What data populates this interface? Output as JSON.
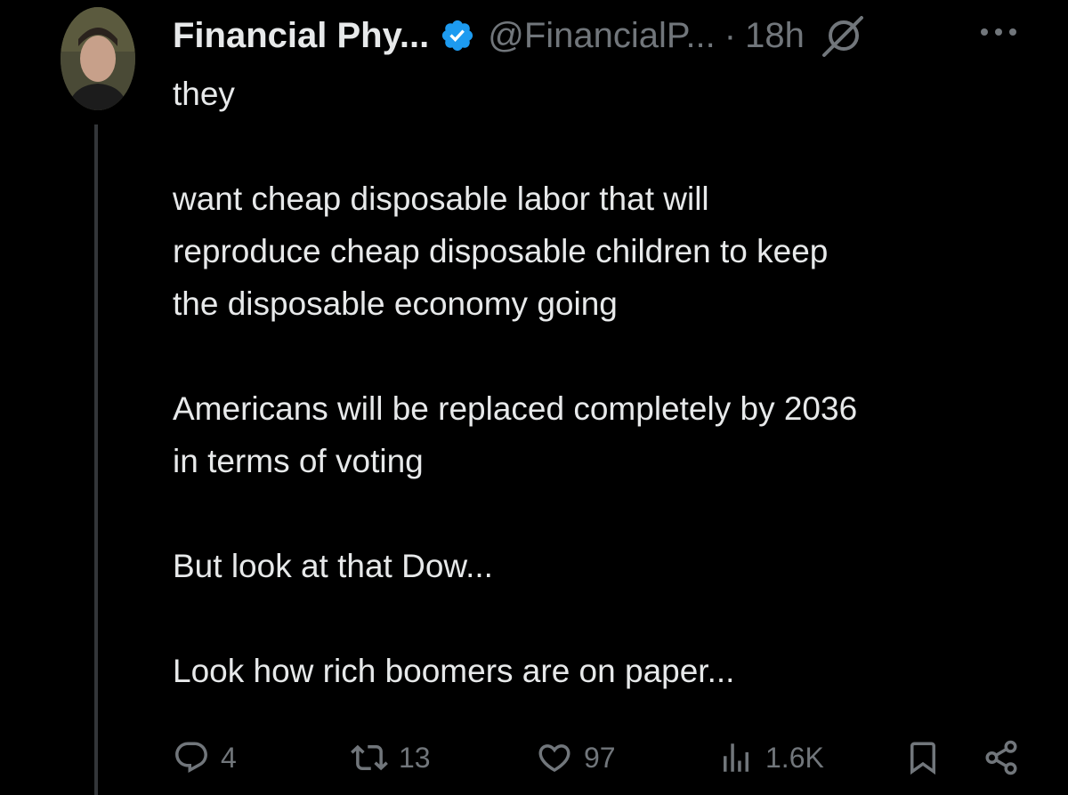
{
  "author": {
    "display_name": "Financial Phy...",
    "handle": "@FinancialP...",
    "separator": "·",
    "time": "18h",
    "verified_color": "#1d9bf0"
  },
  "post": {
    "text": "they\n\nwant cheap disposable labor that will\nreproduce cheap disposable children to keep\nthe disposable economy going\n\nAmericans will be replaced completely by 2036\nin terms of voting\n\nBut look at that Dow...\n\nLook how rich boomers are on paper..."
  },
  "actions": {
    "replies": "4",
    "reposts": "13",
    "likes": "97",
    "views": "1.6K"
  },
  "icons": {
    "avatar": "profile-photo",
    "verified": "verified-badge-icon",
    "grok": "grok-icon",
    "more": "more-dots-icon",
    "reply": "reply-icon",
    "repost": "repost-icon",
    "like": "heart-icon",
    "views": "views-bar-icon",
    "bookmark": "bookmark-icon",
    "share": "share-icon"
  },
  "colors": {
    "background": "#000000",
    "text": "#e7e9ea",
    "muted": "#71767b",
    "thread_line": "#333639"
  }
}
